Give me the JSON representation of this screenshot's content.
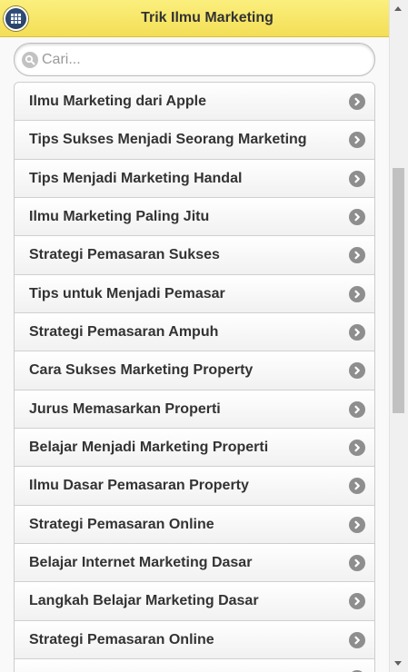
{
  "header": {
    "title": "Trik Ilmu Marketing",
    "menu_icon": "grid-menu-icon"
  },
  "search": {
    "placeholder": "Cari...",
    "value": "",
    "icon": "search-icon"
  },
  "list": {
    "items": [
      {
        "label": "Ilmu Marketing dari Apple"
      },
      {
        "label": "Tips Sukses Menjadi Seorang Marketing"
      },
      {
        "label": "Tips Menjadi Marketing Handal"
      },
      {
        "label": "Ilmu Marketing Paling Jitu"
      },
      {
        "label": "Strategi Pemasaran Sukses"
      },
      {
        "label": "Tips untuk Menjadi Pemasar"
      },
      {
        "label": "Strategi Pemasaran Ampuh"
      },
      {
        "label": "Cara Sukses Marketing Property"
      },
      {
        "label": "Jurus Memasarkan Properti"
      },
      {
        "label": "Belajar Menjadi Marketing Properti"
      },
      {
        "label": "Ilmu Dasar Pemasaran Property"
      },
      {
        "label": "Strategi Pemasaran Online"
      },
      {
        "label": "Belajar Internet Marketing Dasar"
      },
      {
        "label": "Langkah Belajar Marketing Dasar"
      },
      {
        "label": "Strategi Pemasaran Online"
      },
      {
        "label": ""
      }
    ],
    "item_icon": "chevron-right-icon"
  },
  "colors": {
    "header_top": "#fbef7e",
    "header_bottom": "#f3de56",
    "menu_button": "#2c4670",
    "text": "#333333",
    "arrow_icon": "#8e8e8e"
  }
}
